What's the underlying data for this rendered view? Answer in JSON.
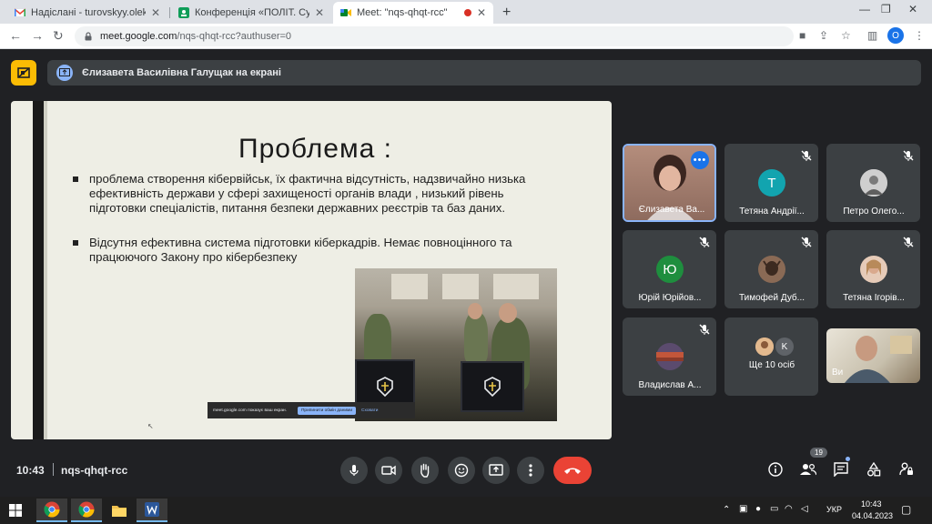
{
  "browser": {
    "tabs": [
      {
        "title": "Надіслані - turovskyy.oleksandr@",
        "favicon": "gmail-icon",
        "active": false
      },
      {
        "title": "Конференція «ПОЛІТ. Сучасні п",
        "favicon": "classroom-icon",
        "active": false
      },
      {
        "title": "Meet: \"nqs-qhqt-rcc\"",
        "favicon": "meet-icon",
        "active": true
      }
    ],
    "url_host": "meet.google.com",
    "url_path": "/nqs-qhqt-rcc?authuser=0",
    "profile_initial": "O"
  },
  "meet": {
    "presenting_banner": "Єлизавета Василівна Галущак на екрані",
    "slide": {
      "title": "Проблема :",
      "bullets": [
        "проблема створення кібервійськ, їх фактична відсутність, надзвичайно низька ефективність держави у сфері захищеності  органів  влади ,  низький рівень підготовки спеціалістів,  питання безпеки державних реєстрів та баз даних.",
        "Відсутня ефективна система підготовки кіберкадрів. Немає повноцінного та працюючого Закону про кібербезпеку"
      ],
      "share_bar": {
        "text": "meet.google.com показує ваш екран.",
        "stop": "Припинити обмін даними",
        "hide": "Сховати"
      }
    },
    "participants": [
      {
        "name": "Єлизавета Ва...",
        "type": "video-girl",
        "active": true,
        "muted": false
      },
      {
        "name": "Тетяна Андрії...",
        "type": "letter",
        "letter": "Т",
        "color": "#12a4af",
        "muted": true
      },
      {
        "name": "Петро Олего...",
        "type": "photo",
        "color": "#9b9b9b",
        "muted": true
      },
      {
        "name": "Юрій Юрійов...",
        "type": "letter",
        "letter": "Ю",
        "color": "#1e8e3e",
        "muted": true
      },
      {
        "name": "Тимофей Дуб...",
        "type": "photo",
        "color": "#6d4b38",
        "muted": true
      },
      {
        "name": "Тетяна Ігорів...",
        "type": "photo",
        "color": "#d4a38a",
        "muted": true
      },
      {
        "name": "Владислав А...",
        "type": "photo",
        "color": "#a35a3f",
        "muted": true
      },
      {
        "name": "Ще 10 осіб",
        "type": "more",
        "letter": "K",
        "muted": false
      },
      {
        "name": "Ви",
        "type": "video-man",
        "muted": false
      }
    ],
    "footer": {
      "time": "10:43",
      "meeting_code": "nqs-qhqt-rcc",
      "participant_count": "19"
    }
  },
  "taskbar": {
    "lang": "УКР",
    "clock_time": "10:43",
    "clock_date": "04.04.2023"
  },
  "colors": {
    "meet_bg": "#202124",
    "end_call": "#ea4335",
    "accent_blue": "#8ab4f8"
  }
}
